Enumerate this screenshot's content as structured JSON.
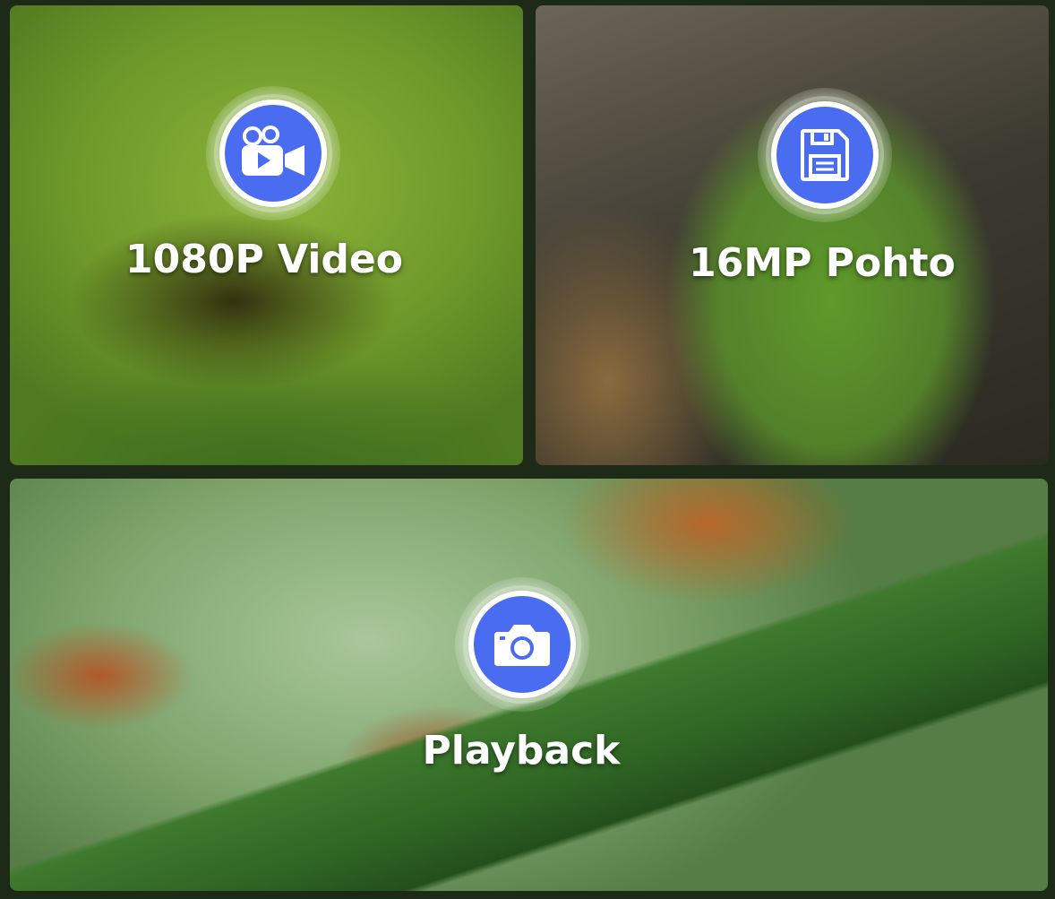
{
  "features": [
    {
      "label": "1080P Video",
      "icon": "video-camera-icon"
    },
    {
      "label": "16MP Pohto",
      "icon": "floppy-disk-icon"
    },
    {
      "label": "Playback",
      "icon": "camera-icon"
    }
  ],
  "colors": {
    "badge_fill": "#4a6cf0",
    "badge_ring": "#ffffff",
    "label_text": "#ffffff"
  }
}
